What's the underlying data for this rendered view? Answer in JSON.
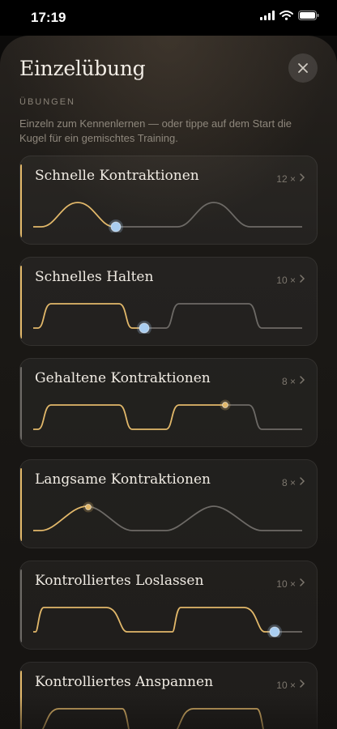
{
  "status": {
    "time": "17:19"
  },
  "sheet": {
    "title": "Einzelübung",
    "section_label": "ÜBUNGEN",
    "description": "Einzeln zum Kennenlernen — oder tippe auf dem Start die Kugel für ein gemischtes Training."
  },
  "colors": {
    "gold": "#e2b86a",
    "blue": "#a9cdf0",
    "grey": "#6d6a66"
  },
  "exercises": [
    {
      "title": "Schnelle Kontraktionen",
      "count": "12 ×",
      "accent": "gold",
      "dot": "blue"
    },
    {
      "title": "Schnelles Halten",
      "count": "10 ×",
      "accent": "gold",
      "dot": "blue"
    },
    {
      "title": "Gehaltene Kontraktionen",
      "count": "8 ×",
      "accent": "grey",
      "dot": "gold"
    },
    {
      "title": "Langsame Kontraktionen",
      "count": "8 ×",
      "accent": "gold",
      "dot": "gold"
    },
    {
      "title": "Kontrolliertes Loslassen",
      "count": "10 ×",
      "accent": "grey",
      "dot": "blue"
    },
    {
      "title": "Kontrolliertes Anspannen",
      "count": "10 ×",
      "accent": "gold",
      "dot": "none"
    }
  ]
}
